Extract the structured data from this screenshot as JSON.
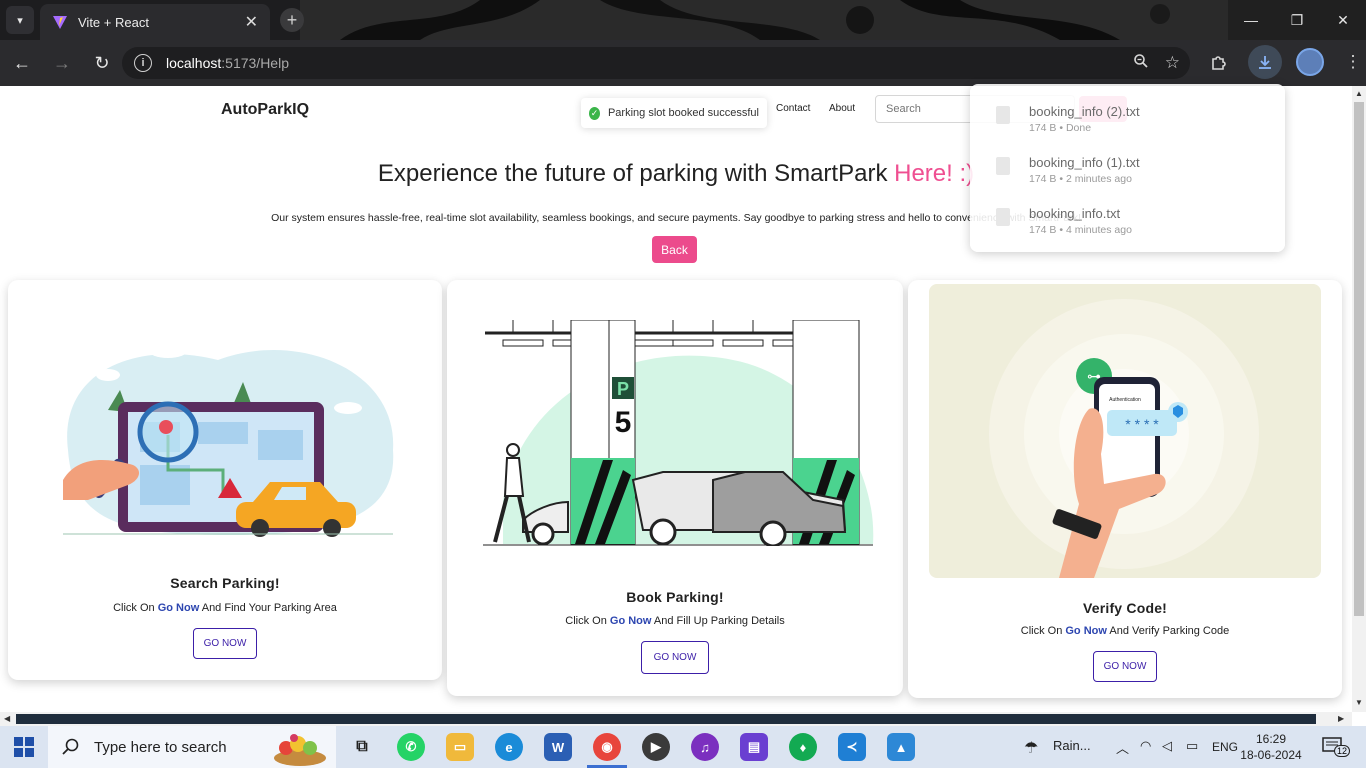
{
  "browser": {
    "tab_title": "Vite + React",
    "url_host": "localhost",
    "url_path": ":5173/Help"
  },
  "navbar": {
    "brand": "AutoParkIQ",
    "links": [
      "Contact",
      "About"
    ],
    "search_placeholder": "Search"
  },
  "toast": {
    "message": "Parking slot booked successful"
  },
  "hero": {
    "title_main": "Experience the future of parking with SmartPark ",
    "title_accent": "Here! :)",
    "subtitle": "Our system ensures hassle-free, real-time slot availability, seamless bookings, and secure payments. Say goodbye to parking stress and hello to convenience with SmartPark!",
    "back_label": "Back"
  },
  "cards": [
    {
      "title": "Search Parking!",
      "desc_prefix": "Click On ",
      "desc_link": "Go Now",
      "desc_suffix": " And Find Your Parking Area",
      "button": "GO NOW"
    },
    {
      "title": "Book Parking!",
      "desc_prefix": "Click On ",
      "desc_link": "Go Now",
      "desc_suffix": " And Fill Up Parking Details",
      "button": "GO NOW"
    },
    {
      "title": "Verify Code!",
      "desc_prefix": "Click On ",
      "desc_link": "Go Now",
      "desc_suffix": " And Verify Parking Code",
      "button": "GO NOW"
    }
  ],
  "illustration_text": {
    "parking_letter": "P",
    "parking_number": "5",
    "auth_label": "Authentication",
    "pin_mask": "* * * *"
  },
  "downloads": [
    {
      "name": "booking_info (2).txt",
      "meta": "174 B • Done"
    },
    {
      "name": "booking_info (1).txt",
      "meta": "174 B • 2 minutes ago"
    },
    {
      "name": "booking_info.txt",
      "meta": "174 B • 4 minutes ago"
    }
  ],
  "taskbar": {
    "search_text": "Type here to search",
    "weather": "Rain...",
    "language": "ENG",
    "time": "16:29",
    "date": "18-06-2024",
    "notifications": "12"
  },
  "colors": {
    "accent_pink": "#ec4b8c",
    "link_blue": "#2d46b0",
    "button_purple": "#3c1fa8",
    "chrome_dark": "#2b2b2e"
  }
}
